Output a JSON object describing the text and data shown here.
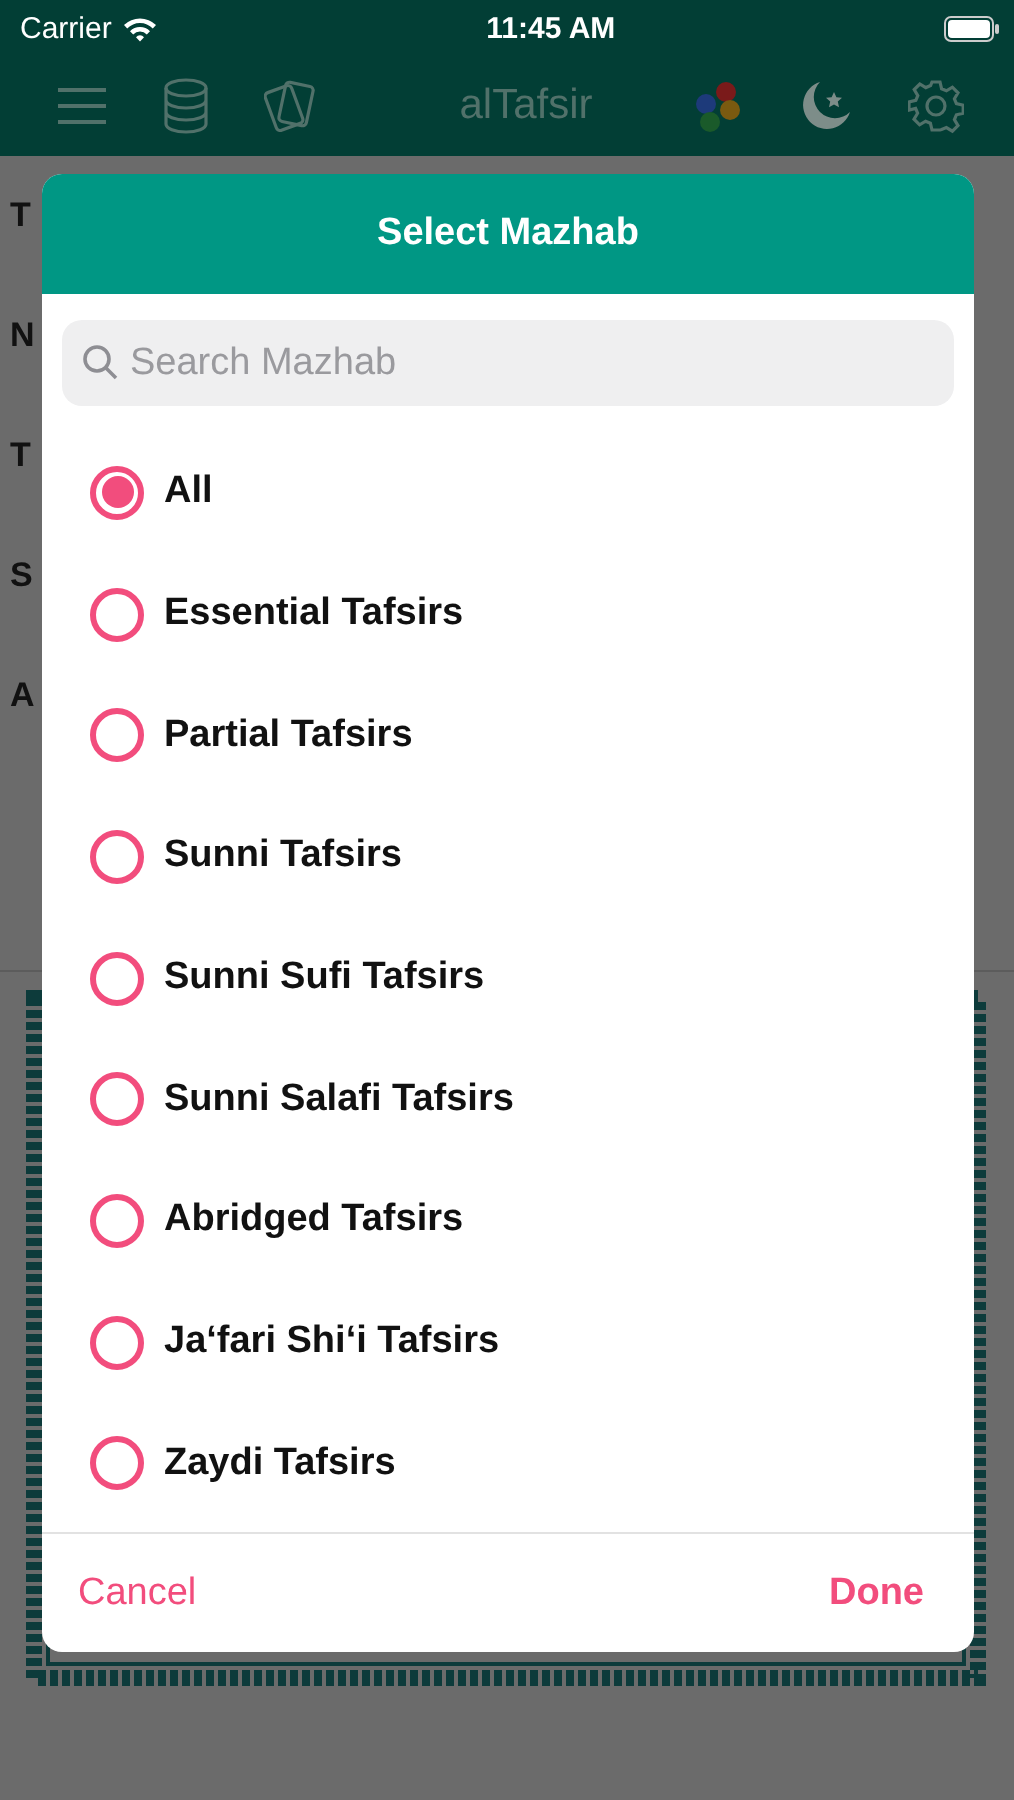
{
  "status_bar": {
    "carrier": "Carrier",
    "time": "11:45 AM"
  },
  "nav_bar": {
    "title": "alTafsir"
  },
  "background_items": [
    "T",
    "N",
    "T",
    "S",
    "A"
  ],
  "dialog": {
    "title": "Select Mazhab",
    "search": {
      "placeholder": "Search Mazhab"
    },
    "options": [
      {
        "label": "All",
        "selected": true
      },
      {
        "label": "Essential Tafsirs",
        "selected": false
      },
      {
        "label": "Partial Tafsirs",
        "selected": false
      },
      {
        "label": "Sunni Tafsirs",
        "selected": false
      },
      {
        "label": "Sunni Sufi Tafsirs",
        "selected": false
      },
      {
        "label": "Sunni Salafi Tafsirs",
        "selected": false
      },
      {
        "label": "Abridged Tafsirs",
        "selected": false
      },
      {
        "label": "Ja‘fari Shi‘i Tafsirs",
        "selected": false
      },
      {
        "label": "Zaydi Tafsirs",
        "selected": false
      }
    ],
    "buttons": [
      {
        "label": "Cancel",
        "kind": "cancel"
      },
      {
        "label": "Done",
        "kind": "confirm"
      }
    ]
  }
}
